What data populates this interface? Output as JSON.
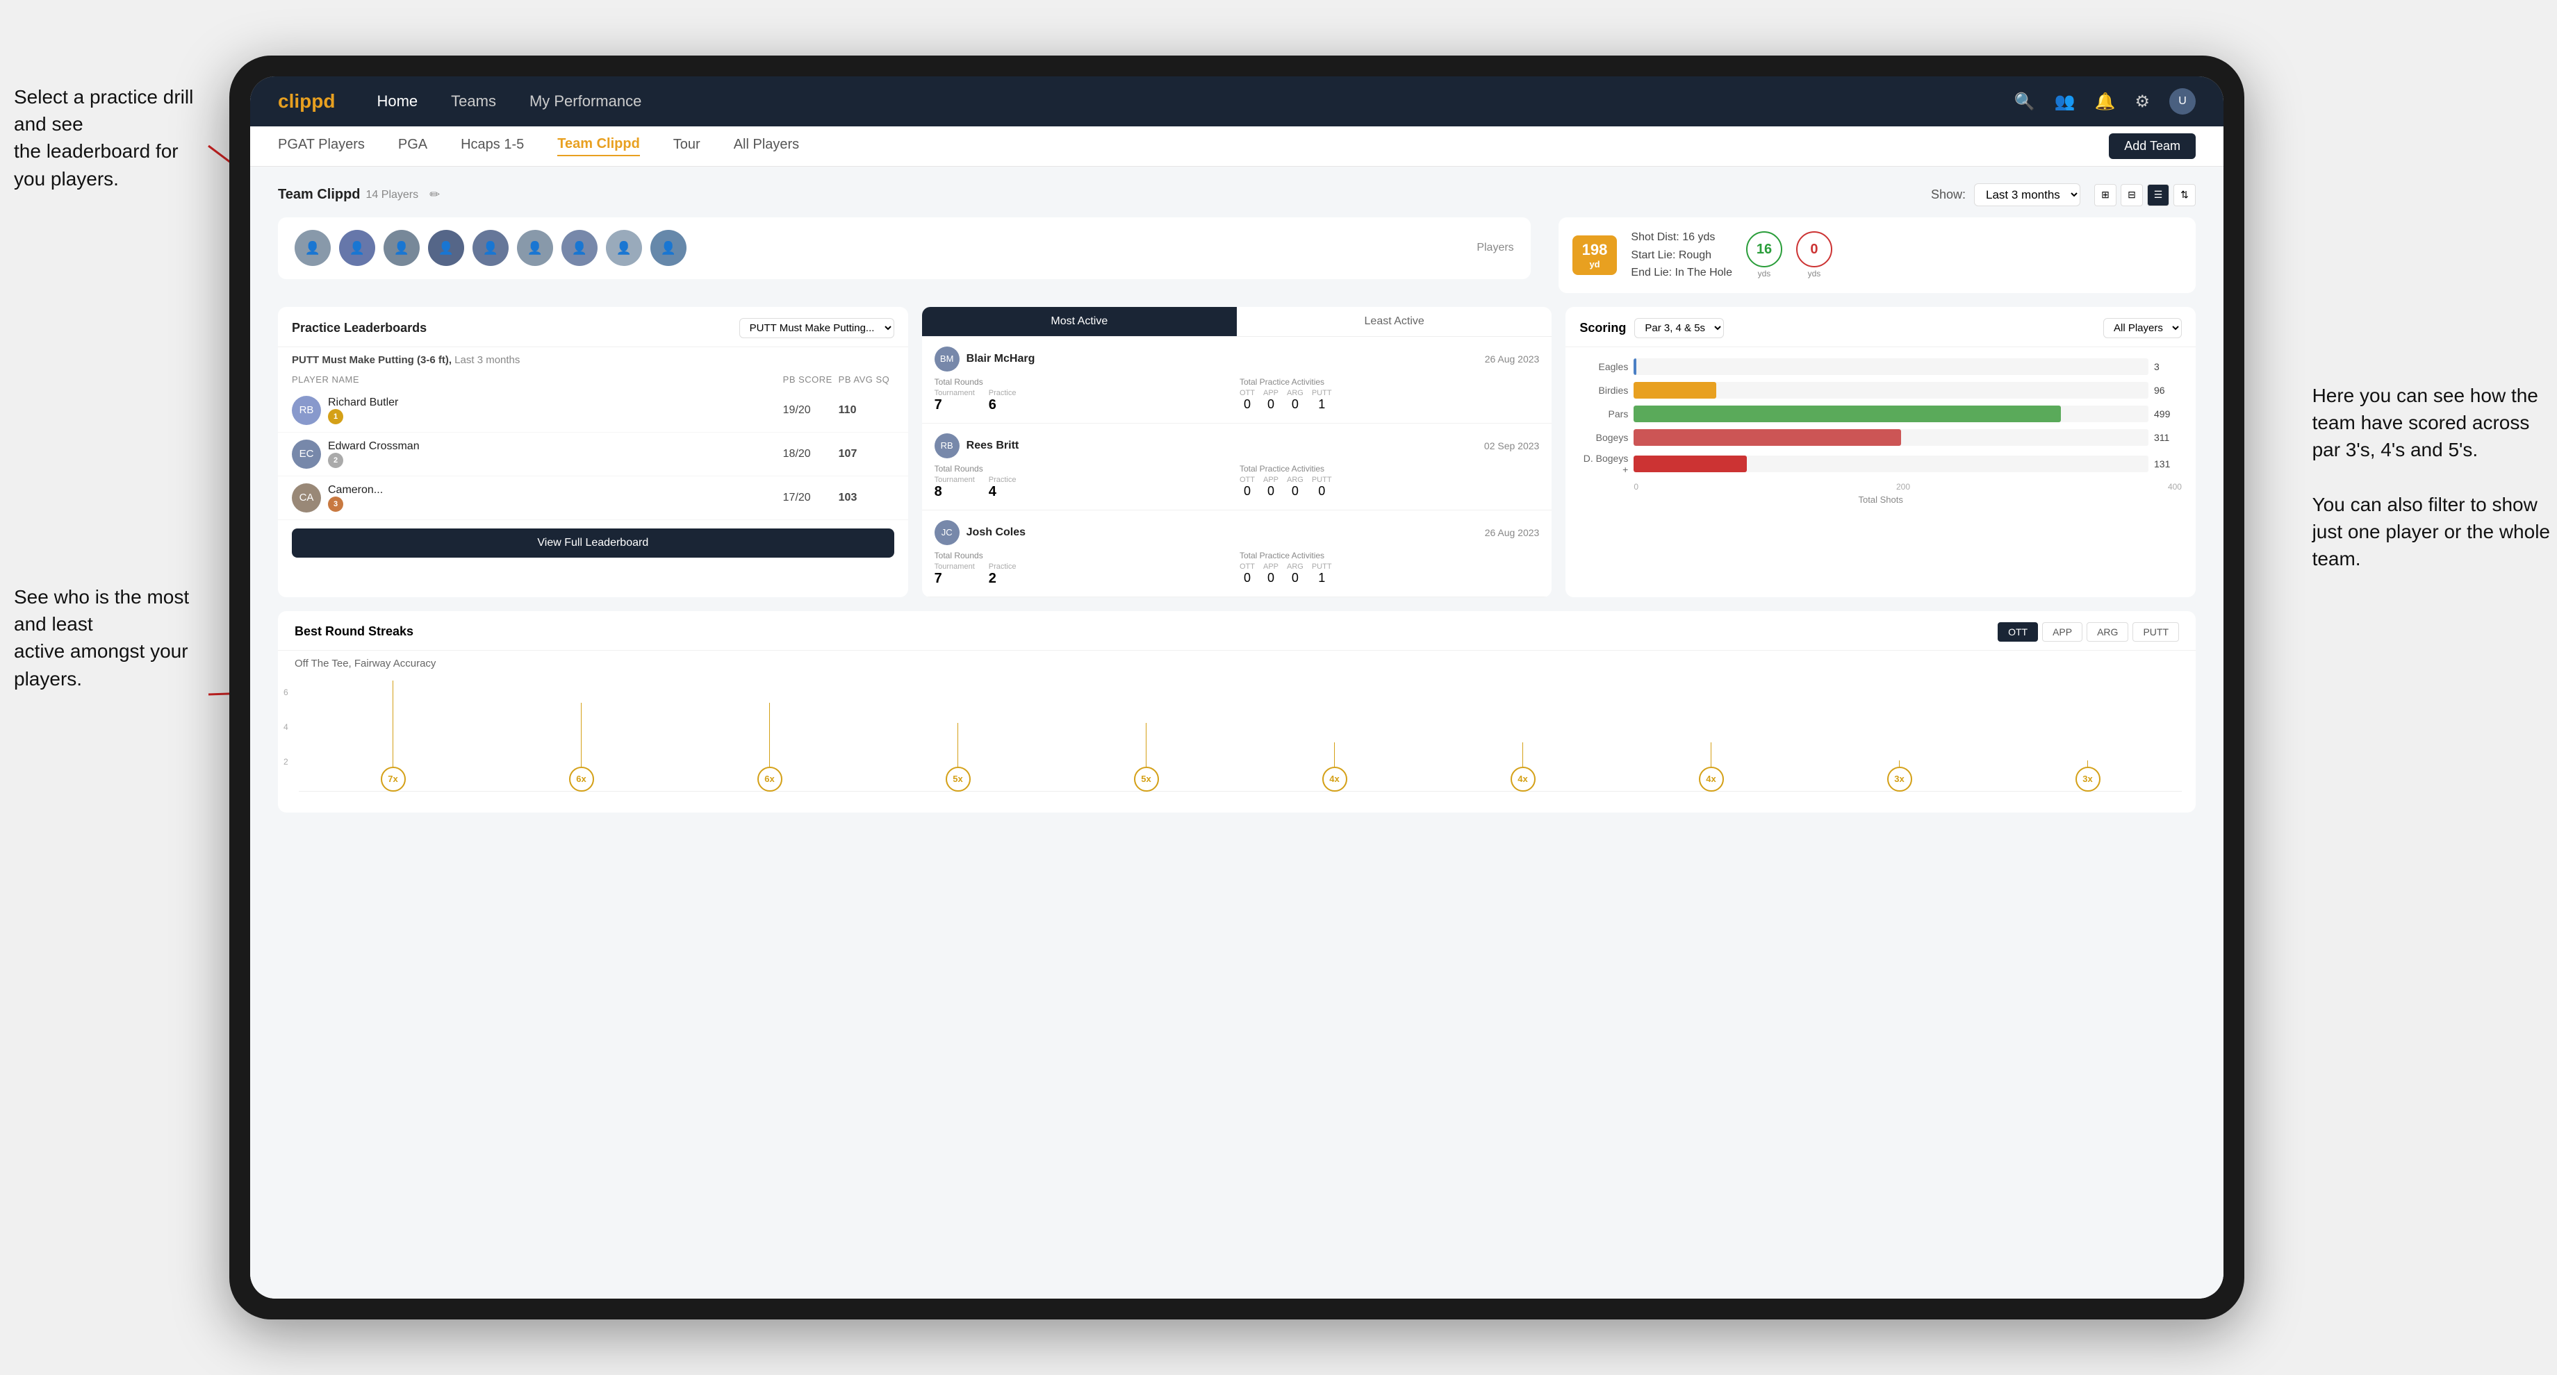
{
  "annotations": {
    "top_left": "Select a practice drill and see\nthe leaderboard for you players.",
    "bottom_left": "See who is the most and least\nactive amongst your players.",
    "right": "Here you can see how the\nteam have scored across\npar 3's, 4's and 5's.\n\nYou can also filter to show\njust one player or the whole\nteam."
  },
  "navbar": {
    "logo": "clippd",
    "links": [
      "Home",
      "Teams",
      "My Performance"
    ],
    "icons": [
      "search",
      "people",
      "bell",
      "settings",
      "user"
    ]
  },
  "subnav": {
    "items": [
      "PGAT Players",
      "PGA",
      "Hcaps 1-5",
      "Team Clippd",
      "Tour",
      "All Players"
    ],
    "active": "Team Clippd",
    "add_button": "Add Team"
  },
  "team_header": {
    "title": "Team Clippd",
    "player_count": "14 Players",
    "show_label": "Show:",
    "show_value": "Last 3 months",
    "view_modes": [
      "grid-2",
      "grid-3",
      "list",
      "filter"
    ]
  },
  "players_label": "Players",
  "shot_info": {
    "distance": "198",
    "unit": "yd",
    "shot_dist_label": "Shot Dist: 16 yds",
    "start_lie_label": "Start Lie: Rough",
    "end_lie_label": "End Lie: In The Hole",
    "yards_start": "16",
    "yards_start_unit": "yds",
    "yards_end": "0",
    "yards_end_unit": "yds"
  },
  "practice_leaderboard": {
    "title": "Practice Leaderboards",
    "drill": "PUTT Must Make Putting...",
    "subtitle": "PUTT Must Make Putting (3-6 ft),",
    "period": "Last 3 months",
    "headers": [
      "PLAYER NAME",
      "PB SCORE",
      "PB AVG SQ"
    ],
    "players": [
      {
        "name": "Richard Butler",
        "score": "19/20",
        "avg": "110",
        "badge": "gold",
        "badge_num": "1"
      },
      {
        "name": "Edward Crossman",
        "score": "18/20",
        "avg": "107",
        "badge": "silver",
        "badge_num": "2"
      },
      {
        "name": "Cameron...",
        "score": "17/20",
        "avg": "103",
        "badge": "bronze",
        "badge_num": "3"
      }
    ],
    "view_full_button": "View Full Leaderboard"
  },
  "active_players": {
    "tabs": [
      "Most Active",
      "Least Active"
    ],
    "active_tab": "Most Active",
    "players": [
      {
        "name": "Blair McHarg",
        "date": "26 Aug 2023",
        "total_rounds_label": "Total Rounds",
        "tournament": "7",
        "practice": "6",
        "practice_activities_label": "Total Practice Activities",
        "ott": "0",
        "app": "0",
        "arg": "0",
        "putt": "1"
      },
      {
        "name": "Rees Britt",
        "date": "02 Sep 2023",
        "total_rounds_label": "Total Rounds",
        "tournament": "8",
        "practice": "4",
        "practice_activities_label": "Total Practice Activities",
        "ott": "0",
        "app": "0",
        "arg": "0",
        "putt": "0"
      },
      {
        "name": "Josh Coles",
        "date": "26 Aug 2023",
        "total_rounds_label": "Total Rounds",
        "tournament": "7",
        "practice": "2",
        "practice_activities_label": "Total Practice Activities",
        "ott": "0",
        "app": "0",
        "arg": "0",
        "putt": "1"
      }
    ]
  },
  "scoring": {
    "title": "Scoring",
    "filter": "Par 3, 4 & 5s",
    "all_players": "All Players",
    "bars": [
      {
        "label": "Eagles",
        "value": 3,
        "max": 600,
        "color": "bar-eagles"
      },
      {
        "label": "Birdies",
        "value": 96,
        "max": 600,
        "color": "bar-birdies"
      },
      {
        "label": "Pars",
        "value": 499,
        "max": 600,
        "color": "bar-pars"
      },
      {
        "label": "Bogeys",
        "value": 311,
        "max": 600,
        "color": "bar-bogeys"
      },
      {
        "label": "D. Bogeys +",
        "value": 131,
        "max": 600,
        "color": "bar-doublebogeys"
      }
    ],
    "x_axis": [
      "0",
      "200",
      "400"
    ],
    "total_shots_label": "Total Shots"
  },
  "streaks": {
    "title": "Best Round Streaks",
    "subtitle": "Off The Tee, Fairway Accuracy",
    "filters": [
      "OTT",
      "APP",
      "ARG",
      "PUTT"
    ],
    "active_filter": "OTT",
    "points": [
      {
        "multiplier": "7x",
        "height": 140
      },
      {
        "multiplier": "6x",
        "height": 115
      },
      {
        "multiplier": "6x",
        "height": 115
      },
      {
        "multiplier": "5x",
        "height": 90
      },
      {
        "multiplier": "5x",
        "height": 90
      },
      {
        "multiplier": "4x",
        "height": 68
      },
      {
        "multiplier": "4x",
        "height": 68
      },
      {
        "multiplier": "4x",
        "height": 68
      },
      {
        "multiplier": "3x",
        "height": 46
      },
      {
        "multiplier": "3x",
        "height": 46
      }
    ],
    "y_labels": [
      "6",
      "4",
      "2"
    ]
  }
}
